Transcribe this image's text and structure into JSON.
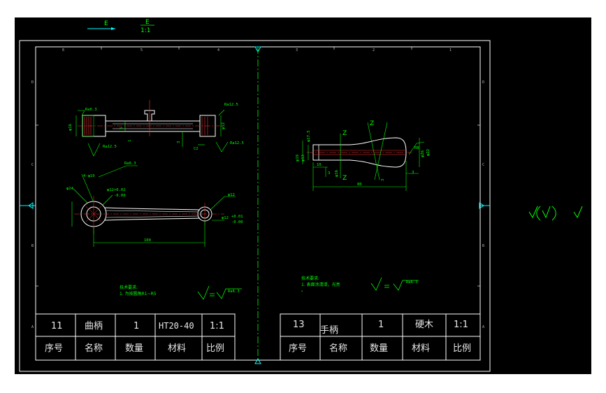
{
  "view_label": {
    "left_letter": "E",
    "right_letter": "E",
    "scale": "1:1"
  },
  "zone_numbers": {
    "top": [
      "6",
      "5",
      "4",
      "3",
      "2",
      "1"
    ],
    "side": [
      "D",
      "C",
      "B",
      "A"
    ]
  },
  "left_drawing": {
    "roughness": [
      "Ra6.3",
      "Ra12.5",
      "Ra12.5",
      "Ra12.5",
      "Ra6.3"
    ],
    "dims": [
      "φ16",
      "φ12",
      "φ12",
      "5",
      "3",
      "1",
      "C2",
      "φ24",
      "φ12",
      "φ12",
      "100",
      "+0.02",
      "-0.00",
      "+0.01",
      "-0.00",
      "4-φ10"
    ],
    "notes_title": "技术要求:",
    "notes_line1": "1. 为按圆角R1~R5",
    "symbol_value": "Ra6.3"
  },
  "right_drawing": {
    "dims": [
      "φ19",
      "φ13",
      "φ17.5",
      "φ16",
      "φ26",
      "φ22",
      "10",
      "3",
      "80",
      "3",
      "3",
      "R8"
    ],
    "notes_title": "技术要求:",
    "notes_line1": "1. 表面涂清漆，光亮",
    "notes_line2": "。",
    "symbol_value": "Ra6.3"
  },
  "title_blocks": {
    "left": {
      "values": [
        "11",
        "曲柄",
        "1",
        "HT20-40",
        "1:1"
      ],
      "headers": [
        "序号",
        "名称",
        "数量",
        "材料",
        "比例"
      ]
    },
    "right": {
      "values": [
        "13",
        "手柄",
        "1",
        "硬木",
        "1:1"
      ],
      "headers": [
        "序号",
        "名称",
        "数量",
        "材料",
        "比例"
      ]
    }
  },
  "colors": {
    "background": "#000000",
    "frame": "#ffffff",
    "geometry": "#ffffff",
    "dimension": "#00ff00",
    "center_line": "#ff0000",
    "axis": "#00ffff"
  }
}
